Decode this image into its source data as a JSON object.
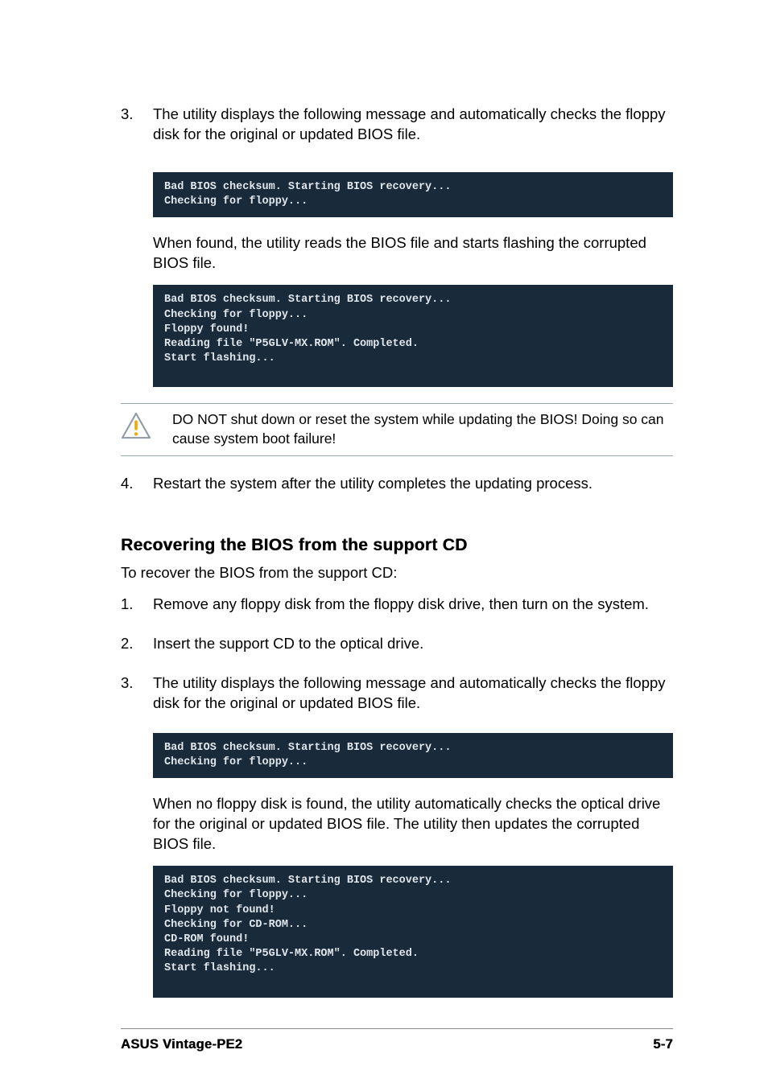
{
  "step3": {
    "num": "3.",
    "text": "The utility displays the following message and automatically checks the floppy disk for the original or updated BIOS file."
  },
  "code1": "Bad BIOS checksum. Starting BIOS recovery...\nChecking for floppy...",
  "found_para": "When found, the utility reads the BIOS file and starts flashing the corrupted BIOS file.",
  "code2": "Bad BIOS checksum. Starting BIOS recovery...\nChecking for floppy...\nFloppy found!\nReading file \"P5GLV-MX.ROM\". Completed.\nStart flashing...",
  "callout_warn": "DO NOT shut down or reset the system while updating the BIOS! Doing so can cause system boot failure!",
  "step4": {
    "num": "4.",
    "text": "Restart the system after the utility completes the updating process."
  },
  "section_heading": "Recovering the BIOS from the support CD",
  "cd_intro": "To recover the BIOS from the support CD:",
  "cd_step1": {
    "num": "1.",
    "text": "Remove any floppy disk from the floppy disk drive, then turn on the system."
  },
  "cd_step2": {
    "num": "2.",
    "text": "Insert the support CD to the optical drive."
  },
  "cd_step3": {
    "num": "3.",
    "text": "The utility displays the following message and automatically checks the floppy disk for the original or updated BIOS file."
  },
  "code3": "Bad BIOS checksum. Starting BIOS recovery...\nChecking for floppy...",
  "nofloppy_para": "When no floppy disk is found, the utility automatically checks the optical drive for the original or updated BIOS file. The utility then updates the corrupted BIOS file.",
  "code4": "Bad BIOS checksum. Starting BIOS recovery...\nChecking for floppy...\nFloppy not found!\nChecking for CD-ROM...\nCD-ROM found!\nReading file \"P5GLV-MX.ROM\". Completed.\nStart flashing...",
  "footer": {
    "left": "ASUS Vintage-PE2",
    "right": "5-7"
  },
  "colors": {
    "code_bg": "#192a3b",
    "code_fg": "#dfe6ec",
    "warn_stroke": "#8f9aa4",
    "warn_fill": "#f6a600"
  }
}
